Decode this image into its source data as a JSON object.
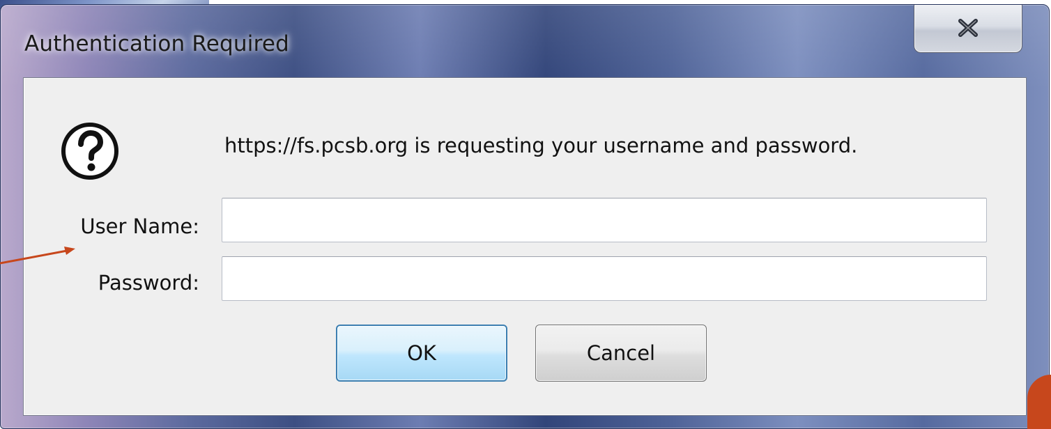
{
  "window": {
    "title": "Authentication Required",
    "close_glyph": "x"
  },
  "dialog": {
    "icon": "question-mark-icon",
    "message": "https://fs.pcsb.org is requesting your username and password.",
    "username_label": "User Name:",
    "username_value": "",
    "password_label": "Password:",
    "password_value": "",
    "ok_label": "OK",
    "cancel_label": "Cancel"
  },
  "colors": {
    "annotation_arrow": "#c7471c",
    "ok_border": "#3c7fb1",
    "accent": "#c7471c"
  }
}
